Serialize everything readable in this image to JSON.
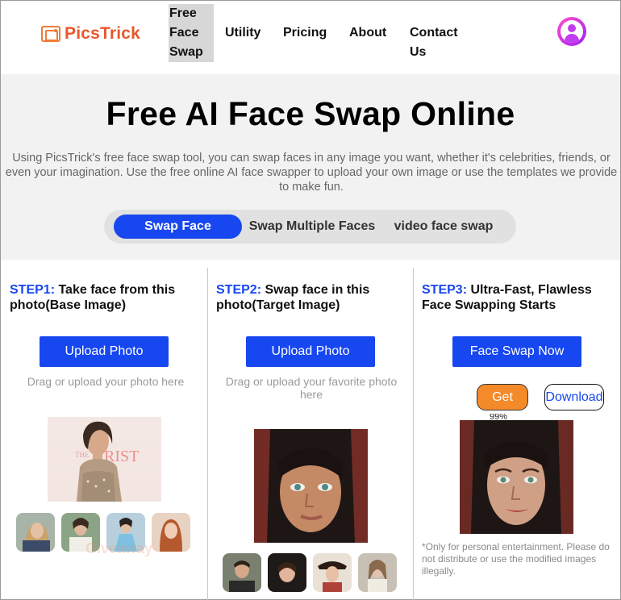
{
  "header": {
    "logo_text": "PicsTrick",
    "nav": [
      {
        "label": "Free Face Swap"
      },
      {
        "label": "Utility"
      },
      {
        "label": "Pricing"
      },
      {
        "label": "About"
      },
      {
        "label": "Contact Us"
      }
    ],
    "avatar_icon": "user-icon"
  },
  "hero": {
    "title": "Free AI Face Swap Online",
    "description": "Using PicsTrick's free face swap tool, you can swap faces in any image you want, whether it's celebrities, friends, or even your imagination. Use the free online AI face swapper to upload your own image or use the templates we provide to make fun.",
    "tabs": [
      {
        "label": "Swap Face",
        "active": true
      },
      {
        "label": "Swap Multiple Faces",
        "active": false
      },
      {
        "label": "video face swap",
        "active": false
      }
    ]
  },
  "steps": [
    {
      "num": "STEP1:",
      "title": "Take face from this photo(Base Image)",
      "button": "Upload Photo",
      "hint": "Drag or upload your photo here"
    },
    {
      "num": "STEP2:",
      "title": "Swap face in this photo(Target Image)",
      "button": "Upload Photo",
      "hint": "Drag or upload your favorite photo here"
    },
    {
      "num": "STEP3:",
      "title": "Ultra-Fast, Flawless Face Swapping Starts",
      "button": "Face Swap Now",
      "get_label": "Get",
      "download_label": "Download",
      "progress": "99%",
      "note": "*Only for personal entertainment. Please do not distribute or use the modified images illegally."
    }
  ],
  "watermark": "Giveaway",
  "colors": {
    "accent": "#1747f0",
    "logo": "#e8572c",
    "get_button": "#f48a2a",
    "hero_bg": "#f2f2f2"
  }
}
